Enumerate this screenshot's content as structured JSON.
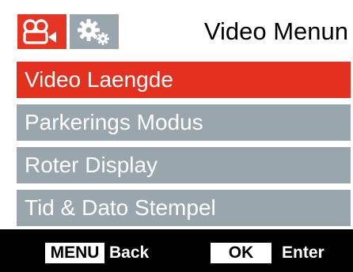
{
  "header": {
    "title": "Video Menun",
    "tabs": [
      {
        "icon": "video-camera-icon",
        "active": true
      },
      {
        "icon": "gears-icon",
        "active": false
      }
    ]
  },
  "menu": {
    "items": [
      {
        "label": "Video Laengde",
        "selected": true
      },
      {
        "label": "Parkerings Modus",
        "selected": false
      },
      {
        "label": "Roter Display",
        "selected": false
      },
      {
        "label": "Tid & Dato Stempel",
        "selected": false
      }
    ]
  },
  "footer": {
    "menu_key": "MENU",
    "menu_action": "Back",
    "ok_key": "OK",
    "ok_action": "Enter"
  },
  "colors": {
    "accent": "#e3301f",
    "item_background": "#9aa6ad",
    "background": "#000000",
    "panel": "#ffffff"
  }
}
